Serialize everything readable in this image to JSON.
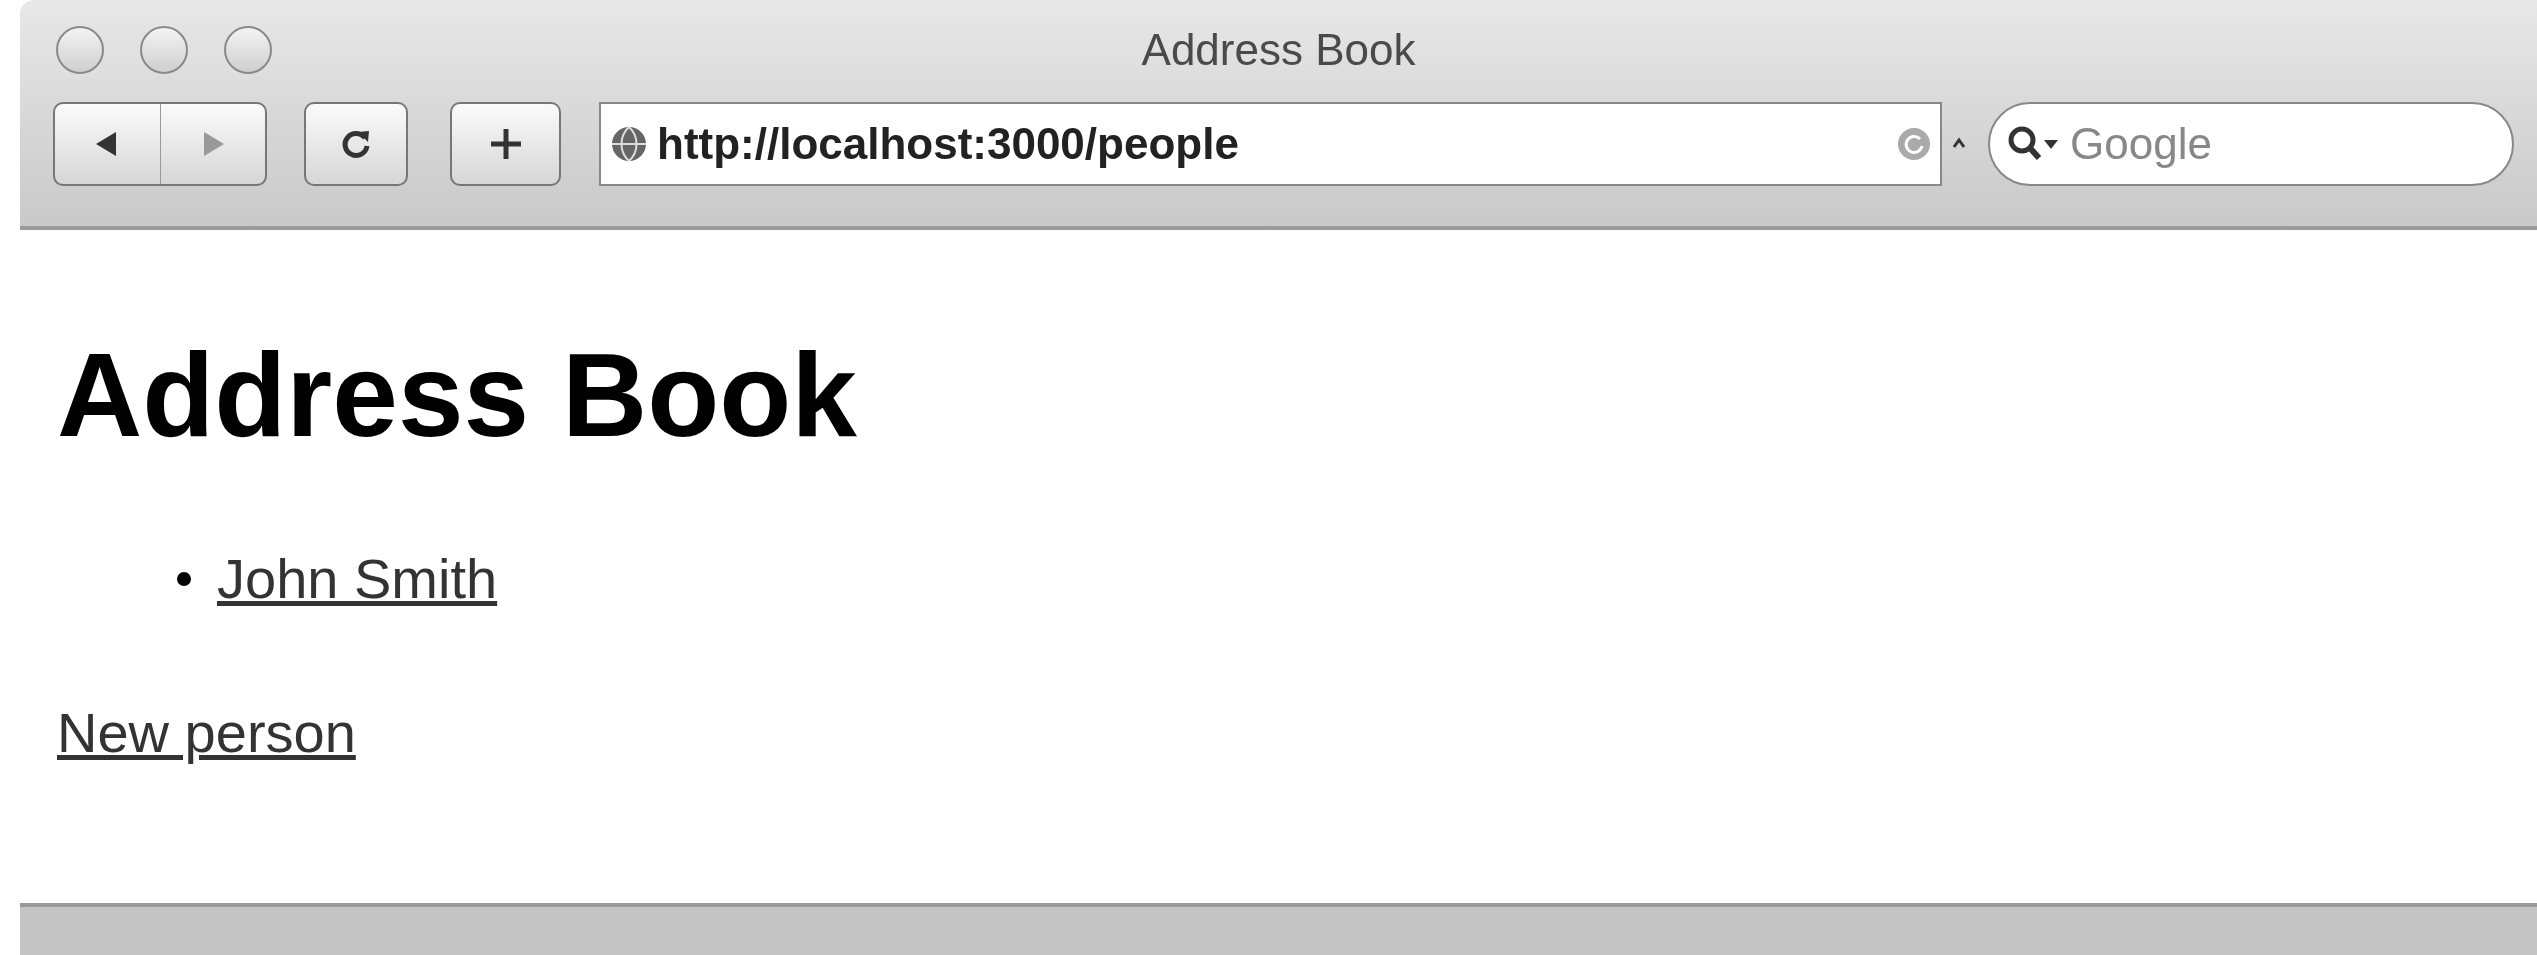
{
  "window": {
    "title": "Address Book"
  },
  "toolbar": {
    "url": "http://localhost:3000/people",
    "search": {
      "placeholder": "Google"
    }
  },
  "page": {
    "heading": "Address Book",
    "people": [
      {
        "name": "John Smith"
      }
    ],
    "new_link": "New person"
  }
}
